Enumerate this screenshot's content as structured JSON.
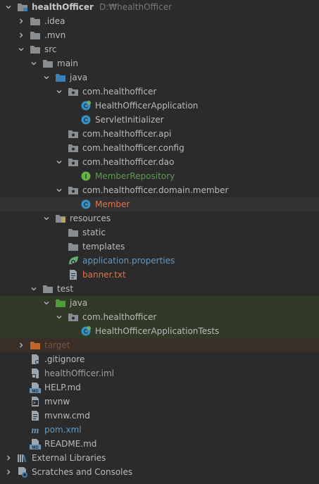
{
  "colors": {
    "default_text": "#bbbbbb",
    "source_text": "#6897bb",
    "modified_text": "#e0734b",
    "added_text": "#629755",
    "ignored_text": "#77563c",
    "folder": "#878d91",
    "source_folder": "#3b81b8",
    "test_folder": "#4f9a3a",
    "excluded_folder": "#c1652f"
  },
  "tree": [
    {
      "depth": 0,
      "arrow": "down",
      "icon": "module-folder-icon",
      "label": "healthOfficer",
      "hint": "D:₩healthOfficer",
      "style": "bold"
    },
    {
      "depth": 1,
      "arrow": "right",
      "icon": "folder-icon",
      "label": ".idea"
    },
    {
      "depth": 1,
      "arrow": "right",
      "icon": "folder-icon",
      "label": ".mvn"
    },
    {
      "depth": 1,
      "arrow": "down",
      "icon": "folder-icon",
      "label": "src"
    },
    {
      "depth": 2,
      "arrow": "down",
      "icon": "folder-icon",
      "label": "main"
    },
    {
      "depth": 3,
      "arrow": "down",
      "icon": "source-folder-icon",
      "label": "java"
    },
    {
      "depth": 4,
      "arrow": "down",
      "icon": "package-icon",
      "label": "com.healthofficer"
    },
    {
      "depth": 5,
      "arrow": "none",
      "icon": "spring-boot-class-icon",
      "label": "HealthOfficerApplication"
    },
    {
      "depth": 5,
      "arrow": "none",
      "icon": "class-icon",
      "label": "ServletInitializer"
    },
    {
      "depth": 4,
      "arrow": "none",
      "icon": "package-icon",
      "label": "com.healthofficer.api"
    },
    {
      "depth": 4,
      "arrow": "none",
      "icon": "package-icon",
      "label": "com.healthofficer.config"
    },
    {
      "depth": 4,
      "arrow": "down",
      "icon": "package-icon",
      "label": "com.healthofficer.dao"
    },
    {
      "depth": 5,
      "arrow": "none",
      "icon": "interface-icon",
      "label": "MemberRepository",
      "color": "added"
    },
    {
      "depth": 4,
      "arrow": "down",
      "icon": "package-icon",
      "label": "com.healthofficer.domain.member"
    },
    {
      "depth": 5,
      "arrow": "none",
      "icon": "class-icon",
      "label": "Member",
      "color": "modified",
      "row": "selected"
    },
    {
      "depth": 3,
      "arrow": "down",
      "icon": "resources-folder-icon",
      "label": "resources"
    },
    {
      "depth": 4,
      "arrow": "none",
      "icon": "folder-icon",
      "label": "static"
    },
    {
      "depth": 4,
      "arrow": "none",
      "icon": "folder-icon",
      "label": "templates"
    },
    {
      "depth": 4,
      "arrow": "none",
      "icon": "spring-properties-icon",
      "label": "application.properties",
      "color": "source"
    },
    {
      "depth": 4,
      "arrow": "none",
      "icon": "text-file-icon",
      "label": "banner.txt",
      "color": "modified"
    },
    {
      "depth": 2,
      "arrow": "down",
      "icon": "folder-icon",
      "label": "test"
    },
    {
      "depth": 3,
      "arrow": "down",
      "icon": "test-folder-icon",
      "label": "java",
      "row": "test"
    },
    {
      "depth": 4,
      "arrow": "down",
      "icon": "package-icon",
      "label": "com.healthofficer",
      "row": "test"
    },
    {
      "depth": 5,
      "arrow": "none",
      "icon": "spring-boot-class-icon",
      "label": "HealthOfficerApplicationTests",
      "row": "test"
    },
    {
      "depth": 1,
      "arrow": "right",
      "icon": "excluded-folder-icon",
      "label": "target",
      "color": "ignored",
      "row": "excluded"
    },
    {
      "depth": 1,
      "arrow": "none",
      "icon": "gitignore-file-icon",
      "label": ".gitignore"
    },
    {
      "depth": 1,
      "arrow": "none",
      "icon": "iml-file-icon",
      "label": "healthOfficer.iml",
      "color": "dim"
    },
    {
      "depth": 1,
      "arrow": "none",
      "icon": "markdown-file-icon",
      "label": "HELP.md"
    },
    {
      "depth": 1,
      "arrow": "none",
      "icon": "shell-file-icon",
      "label": "mvnw"
    },
    {
      "depth": 1,
      "arrow": "none",
      "icon": "text-file-icon",
      "label": "mvnw.cmd"
    },
    {
      "depth": 1,
      "arrow": "none",
      "icon": "maven-pom-icon",
      "label": "pom.xml",
      "color": "source"
    },
    {
      "depth": 1,
      "arrow": "none",
      "icon": "markdown-file-icon",
      "label": "README.md"
    },
    {
      "depth": 0,
      "arrow": "right",
      "icon": "external-libraries-icon",
      "label": "External Libraries"
    },
    {
      "depth": 0,
      "arrow": "right",
      "icon": "scratches-icon",
      "label": "Scratches and Consoles"
    }
  ]
}
